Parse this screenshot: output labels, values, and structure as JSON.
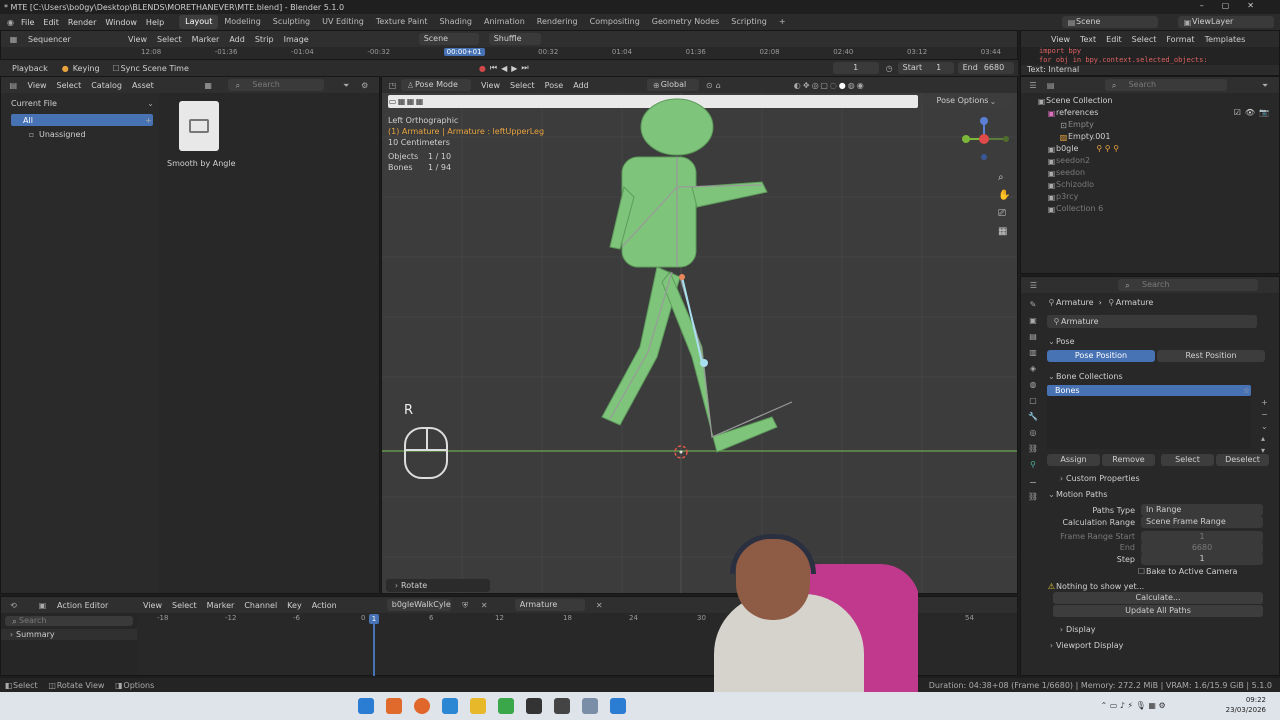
{
  "window_title": "* MTE [C:\\Users\\bo0gy\\Desktop\\BLENDS\\MORETHANEVER\\MTE.blend] - Blender 5.1.0",
  "menu": [
    "File",
    "Edit",
    "Render",
    "Window",
    "Help"
  ],
  "workspaces": [
    "Layout",
    "Modeling",
    "Sculpting",
    "UV Editing",
    "Texture Paint",
    "Shading",
    "Animation",
    "Rendering",
    "Compositing",
    "Geometry Nodes",
    "Scripting"
  ],
  "active_workspace": "Layout",
  "scene_name": "Scene",
  "viewlayer_name": "ViewLayer",
  "sequencer": {
    "editor": "Sequencer",
    "menu": [
      "View",
      "Select",
      "Marker",
      "Add",
      "Strip",
      "Image"
    ],
    "scene": "Scene",
    "shuffle": "Shuffle",
    "ticks": [
      "12:08",
      "-01:36",
      "-01:04",
      "-00:32",
      "00:00+01",
      "00:32",
      "01:04",
      "01:36",
      "02:08",
      "02:40",
      "03:12",
      "03:44"
    ]
  },
  "playback": {
    "playback": "Playback",
    "keying": "Keying",
    "sync": "Sync Scene Time",
    "frame": "1",
    "start_label": "Start",
    "start": "1",
    "end_label": "End",
    "end": "6680"
  },
  "asset_browser": {
    "menu": [
      "View",
      "Select",
      "Catalog",
      "Asset"
    ],
    "search_placeholder": "Search",
    "library": "Current File",
    "all": "All",
    "unassigned": "Unassigned",
    "asset_name": "Smooth by Angle"
  },
  "viewport": {
    "mode": "Pose Mode",
    "menu": [
      "View",
      "Select",
      "Pose",
      "Add"
    ],
    "orientation": "Global",
    "pose_options": "Pose Options",
    "view_name": "Left Orthographic",
    "active": "(1) Armature | Armature : leftUpperLeg",
    "scale": "10 Centimeters",
    "objects_label": "Objects",
    "objects": "1 / 10",
    "bones_label": "Bones",
    "bones": "1 / 94",
    "key_overlay": "R",
    "last_op": "Rotate"
  },
  "text_editor": {
    "menu": [
      "View",
      "Text",
      "Edit",
      "Select",
      "Format",
      "Templates"
    ],
    "line1": "import bpy",
    "line2": "for obj in bpy.context.selected_objects:",
    "status": "Text: Internal"
  },
  "outliner": {
    "search_placeholder": "Search",
    "items": [
      {
        "name": "Scene Collection",
        "color": "#d8d8d8"
      },
      {
        "name": "references",
        "color": "#d8d8d8"
      },
      {
        "name": "Empty",
        "color": "#8a8a8a"
      },
      {
        "name": "Empty.001",
        "color": "#d8d8d8"
      },
      {
        "name": "b0gle",
        "color": "#d8d8d8"
      },
      {
        "name": "seedon2",
        "color": "#7a7a7a"
      },
      {
        "name": "seedon",
        "color": "#7a7a7a"
      },
      {
        "name": "Schizodlo",
        "color": "#7a7a7a"
      },
      {
        "name": "p3rcy",
        "color": "#7a7a7a"
      },
      {
        "name": "Collection 6",
        "color": "#7a7a7a"
      }
    ]
  },
  "properties": {
    "search_placeholder": "Search",
    "breadcrumb_a": "Armature",
    "breadcrumb_b": "Armature",
    "data_name": "Armature",
    "pose_section": "Pose",
    "pose_position": "Pose Position",
    "rest_position": "Rest Position",
    "bone_collections": "Bone Collections",
    "bones_item": "Bones",
    "assign": "Assign",
    "remove": "Remove",
    "select": "Select",
    "deselect": "Deselect",
    "custom_properties": "Custom Properties",
    "motion_paths": "Motion Paths",
    "paths_type_label": "Paths Type",
    "paths_type": "In Range",
    "calc_range_label": "Calculation Range",
    "calc_range": "Scene Frame Range",
    "frame_range_start_label": "Frame Range Start",
    "frame_range_start": "1",
    "end_label": "End",
    "end": "6680",
    "step_label": "Step",
    "step": "1",
    "bake": "Bake to Active Camera",
    "nothing": "Nothing to show yet...",
    "calculate": "Calculate...",
    "update_all": "Update All Paths",
    "display": "Display",
    "viewport_display": "Viewport Display"
  },
  "action_editor": {
    "editor": "Action Editor",
    "menu": [
      "View",
      "Select",
      "Marker",
      "Channel",
      "Key",
      "Action"
    ],
    "action": "b0gleWalkCyle",
    "object": "Armature",
    "search_placeholder": "Search",
    "summary": "Summary",
    "ticks": [
      "-18",
      "-12",
      "-6",
      "0",
      "6",
      "12",
      "18",
      "24",
      "30",
      "54"
    ],
    "current_frame": "1"
  },
  "statusbar": {
    "select": "Select",
    "rotate_view": "Rotate View",
    "options": "Options",
    "info": "Duration: 04:38+08 (Frame 1/6680) | Memory: 272.2 MiB | VRAM: 1.6/15.9 GiB | 5.1.0"
  },
  "taskbar": {
    "time": "09:22",
    "date": "23/03/2026"
  }
}
